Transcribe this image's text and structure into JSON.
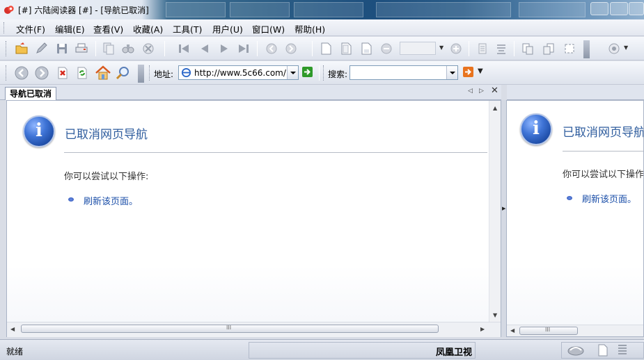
{
  "window": {
    "title": "[#] 六陆阅读器 [#] - [导航已取消]"
  },
  "menu": {
    "items": [
      "文件(F)",
      "编辑(E)",
      "查看(V)",
      "收藏(A)",
      "工具(T)",
      "用户(U)",
      "窗口(W)",
      "帮助(H)"
    ]
  },
  "address_bar": {
    "label": "地址:",
    "url": "http://www.5c66.com/"
  },
  "search_bar": {
    "label": "搜索:",
    "value": ""
  },
  "tabs": [
    {
      "label": "导航已取消",
      "active": true
    }
  ],
  "page": {
    "heading": "已取消网页导航",
    "instruction": "你可以尝试以下操作:",
    "action_link": "刷新该页面。"
  },
  "statusbar": {
    "status": "就绪",
    "brand": "凤凰卫视"
  },
  "colors": {
    "heading": "#2f5d9e",
    "link": "#1a4ea8",
    "titlebar_dark": "#1d4f7e"
  },
  "icons": [
    "app-icon",
    "open-folder-icon",
    "edit-icon",
    "save-icon",
    "print-icon",
    "copy-icon",
    "find-icon",
    "stop-icon",
    "first-page-icon",
    "prev-page-icon",
    "next-page-icon",
    "last-page-icon",
    "back-icon",
    "forward-icon",
    "close-page-icon",
    "refresh-icon",
    "home-icon",
    "search-icon",
    "ie-page-icon",
    "go-icon",
    "info-icon"
  ]
}
